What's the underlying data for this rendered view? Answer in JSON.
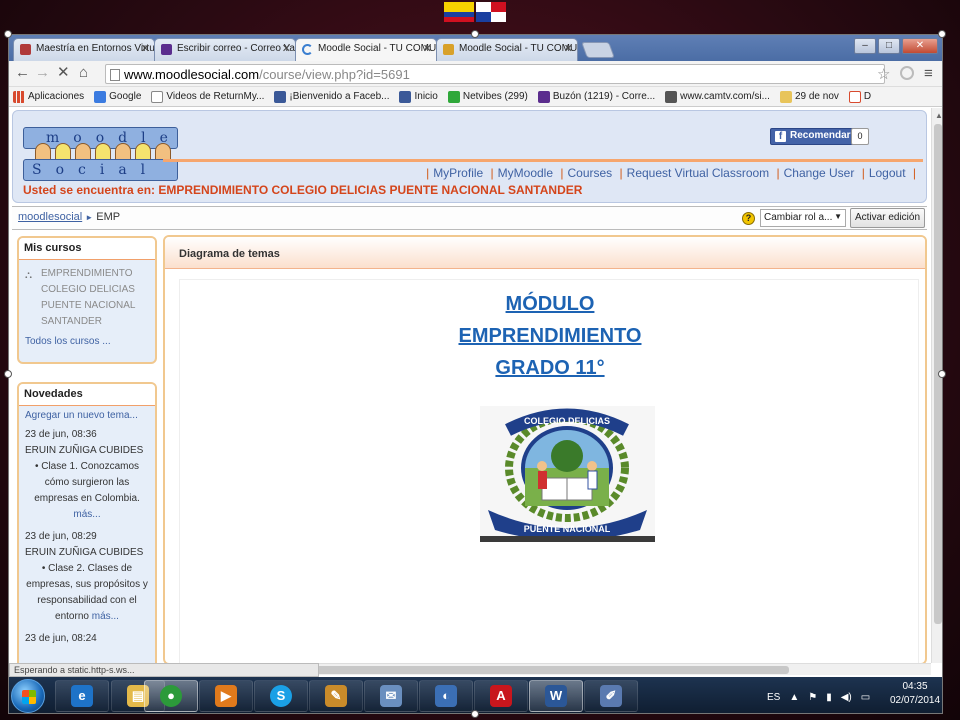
{
  "browser": {
    "tabs": [
      {
        "label": "Maestría en Entornos Virtu",
        "color": "#b03a3a"
      },
      {
        "label": "Escribir correo - Correo Ya",
        "color": "#5b2d8e"
      },
      {
        "label": "Moodle Social - TU COMU",
        "color": "#3a7ed0"
      },
      {
        "label": "Moodle Social - TU COMU",
        "color": "#d8a12a"
      }
    ],
    "window_buttons": {
      "minimize": "–",
      "maximize": "□",
      "close": "✕"
    },
    "url_host": "www.moodlesocial.com",
    "url_path": "/course/view.php?id=5691",
    "nav": {
      "back": "←",
      "forward": "→",
      "stop": "✕",
      "home": "⌂"
    },
    "bookmarks": [
      {
        "label": "Aplicaciones",
        "color": "#d84a2e"
      },
      {
        "label": "Google",
        "color": "#3b7be0"
      },
      {
        "label": "Videos de ReturnMy...",
        "color": "#ffffff"
      },
      {
        "label": "¡Bienvenido a Faceb...",
        "color": "#3b5998"
      },
      {
        "label": "Inicio",
        "color": "#3b5998"
      },
      {
        "label": "Netvibes (299)",
        "color": "#2fa83a"
      },
      {
        "label": "Buzón (1219) - Corre...",
        "color": "#5b2d8e"
      },
      {
        "label": "www.camtv.com/si...",
        "color": "#555555"
      },
      {
        "label": "29 de nov",
        "color": "#e8c45a"
      },
      {
        "label": "D",
        "color": "#d84a2e"
      }
    ]
  },
  "moodle": {
    "logo_top": "moodle",
    "logo_bottom": "Social",
    "fb_label": "Recomendar",
    "fb_count": "0",
    "menu": [
      "MyProfile",
      "MyMoodle",
      "Courses",
      "Request Virtual Classroom",
      "Change User",
      "Logout"
    ],
    "location": "Usted se encuentra en: EMPRENDIMIENTO COLEGIO DELICIAS PUENTE NACIONAL SANTANDER",
    "breadcrumb": {
      "home": "moodlesocial",
      "arrow": "►",
      "current": "EMP"
    },
    "role_select": "Cambiar rol a...",
    "edit_button": "Activar edición",
    "my_courses": {
      "title": "Mis cursos",
      "course_lines": [
        "EMPRENDIMIENTO",
        "COLEGIO DELICIAS",
        "PUENTE NACIONAL",
        "SANTANDER"
      ],
      "all": "Todos los cursos ..."
    },
    "news": {
      "title": "Novedades",
      "add": "Agregar un nuevo tema...",
      "items": [
        {
          "date": "23 de jun, 08:36",
          "author": "ERUIN ZUÑIGA CUBIDES",
          "text": "• Clase 1. Conozcamos cómo surgieron las empresas en Colombia.",
          "more": "más..."
        },
        {
          "date": "23 de jun, 08:29",
          "author": "ERUIN ZUÑIGA CUBIDES",
          "text": "• Clase 2. Clases de empresas, sus propósitos y responsabilidad con el entorno",
          "more": "más..."
        },
        {
          "date": "23 de jun, 08:24",
          "author": "",
          "text": "",
          "more": ""
        }
      ]
    },
    "main_header": "Diagrama de temas",
    "module_title": [
      "MÓDULO",
      "EMPRENDIMIENTO",
      "GRADO 11°"
    ],
    "crest": {
      "top_text": "COLEGIO DELICIAS",
      "bottom_text": "PUENTE NACIONAL"
    }
  },
  "status": "Esperando a static.http-s.ws...",
  "taskbar": {
    "items": [
      {
        "glyph": "e",
        "color": "#1e73c8"
      },
      {
        "glyph": "▤",
        "color": "#e3b94a"
      },
      {
        "glyph": "●",
        "color": "#2c9a3a"
      },
      {
        "glyph": "▶",
        "color": "#e07a1c"
      },
      {
        "glyph": "S",
        "color": "#1aa0e6"
      },
      {
        "glyph": "✎",
        "color": "#c98b2a"
      },
      {
        "glyph": "✉",
        "color": "#6a8fbf"
      },
      {
        "glyph": "◐",
        "color": "#3b6fb5"
      },
      {
        "glyph": "A",
        "color": "#c8161d"
      },
      {
        "glyph": "W",
        "color": "#2b5797"
      },
      {
        "glyph": "✐",
        "color": "#5a7ab0"
      }
    ],
    "lang": "ES",
    "time": "04:35",
    "date": "02/07/2014"
  }
}
